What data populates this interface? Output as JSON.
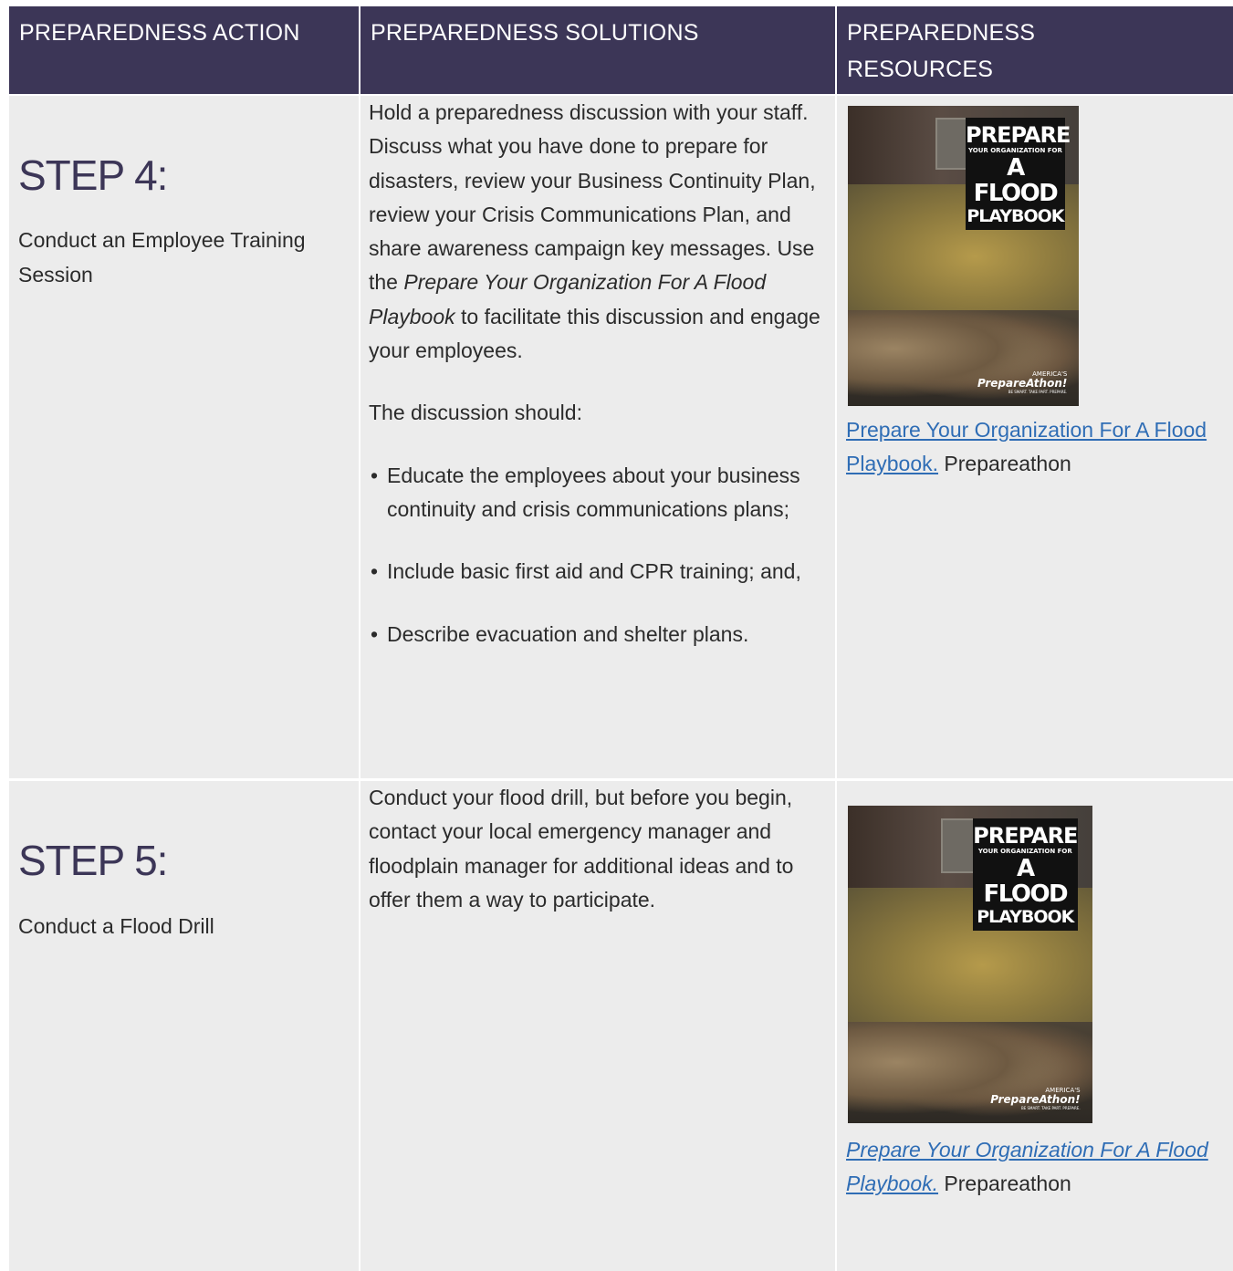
{
  "headers": {
    "action": "PREPAREDNESS ACTION",
    "solutions": "PREPAREDNESS SOLUTIONS",
    "resources_line1": "PREPAREDNESS",
    "resources_line2": "RESOURCES"
  },
  "step4": {
    "title": "STEP 4:",
    "subtitle": "Conduct an Employee Training Session",
    "solution_intro_1": "Hold a preparedness discussion with your staff. Discuss what you have done to prepare for disasters, review your Business Continuity Plan, review your Crisis Communications Plan, and share awareness campaign key messages. Use the ",
    "solution_intro_em": "Prepare Your Organization For A Flood Playbook",
    "solution_intro_2": " to facilitate this discussion and engage your employees.",
    "discussion_lead": "The discussion should:",
    "bullets": [
      "Educate the employees about your business continuity and crisis communications plans;",
      "Include basic first aid and CPR training; and,",
      "Describe evacuation and shelter plans."
    ],
    "resource_link": "Prepare Your Organization For A Flood Playbook.",
    "resource_source": " Prepareathon"
  },
  "step5": {
    "title": "STEP 5:",
    "subtitle": "Conduct a Flood Drill",
    "solution": "Conduct your flood drill, but before you begin, contact your local emergency manager and floodplain manager for additional ideas and to offer them a way to participate.",
    "resource_link": "Prepare Your Organization For A Flood Playbook.",
    "resource_source": " Prepareathon"
  },
  "cover": {
    "line1": "PREPARE",
    "line2": "YOUR ORGANIZATION FOR",
    "line3": "A FLOOD",
    "line4": "PLAYBOOK",
    "brand1": "AMERICA'S",
    "brand2": "PrepareAthon!",
    "brand3": "BE SMART. TAKE PART. PREPARE."
  }
}
